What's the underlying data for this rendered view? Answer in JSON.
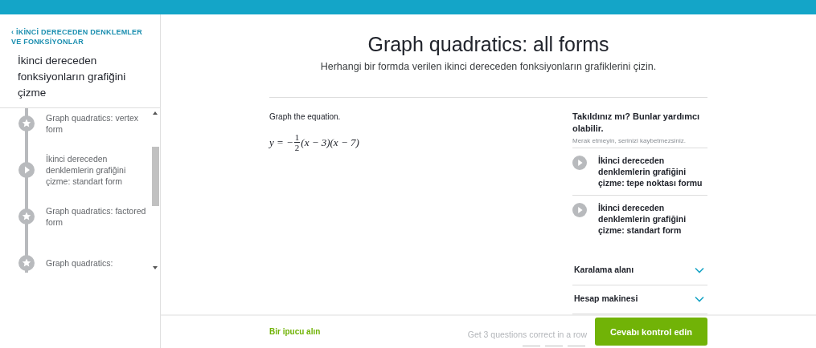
{
  "sidebar": {
    "back_link": "‹ İKİNCİ DERECEDEN DENKLEMLER VE FONKSİYONLAR",
    "title": "İkinci dereceden fonksiyonların grafiğini çizme",
    "items": [
      {
        "kind": "exercise",
        "label": "Graph quadratics: vertex form"
      },
      {
        "kind": "video",
        "label": "İkinci dereceden denklemlerin grafiğini çizme: standart form"
      },
      {
        "kind": "exercise",
        "label": "Graph quadratics: factored form"
      },
      {
        "kind": "exercise",
        "label": "Graph quadratics:"
      }
    ]
  },
  "header": {
    "title": "Graph quadratics: all forms",
    "subtitle": "Herhangi bir formda verilen ikinci dereceden fonksiyonların grafiklerini çizin."
  },
  "question": {
    "prompt": "Graph the equation.",
    "equation": {
      "prefix": "y = −",
      "numerator": "1",
      "denominator": "2",
      "suffix": "(x − 3)(x − 7)"
    }
  },
  "help": {
    "title": "Takıldınız mı? Bunlar yardımcı olabilir.",
    "note": "Merak etmeyin, serinizi kaybetmezsiniz.",
    "videos": [
      {
        "label": "İkinci dereceden denklemlerin grafiğini çizme: tepe noktası formu"
      },
      {
        "label": "İkinci dereceden denklemlerin grafiğini çizme: standart form"
      }
    ],
    "panels": [
      {
        "label": "Karalama alanı",
        "expanded": false
      },
      {
        "label": "Hesap makinesi",
        "expanded": false
      }
    ]
  },
  "footer": {
    "hint_link": "Bir ipucu alın",
    "streak_text": "Get 3 questions correct in a row",
    "streak": [
      {
        "done": false
      },
      {
        "done": false
      },
      {
        "done": false
      }
    ],
    "check_button": "Cevabı kontrol edin"
  }
}
